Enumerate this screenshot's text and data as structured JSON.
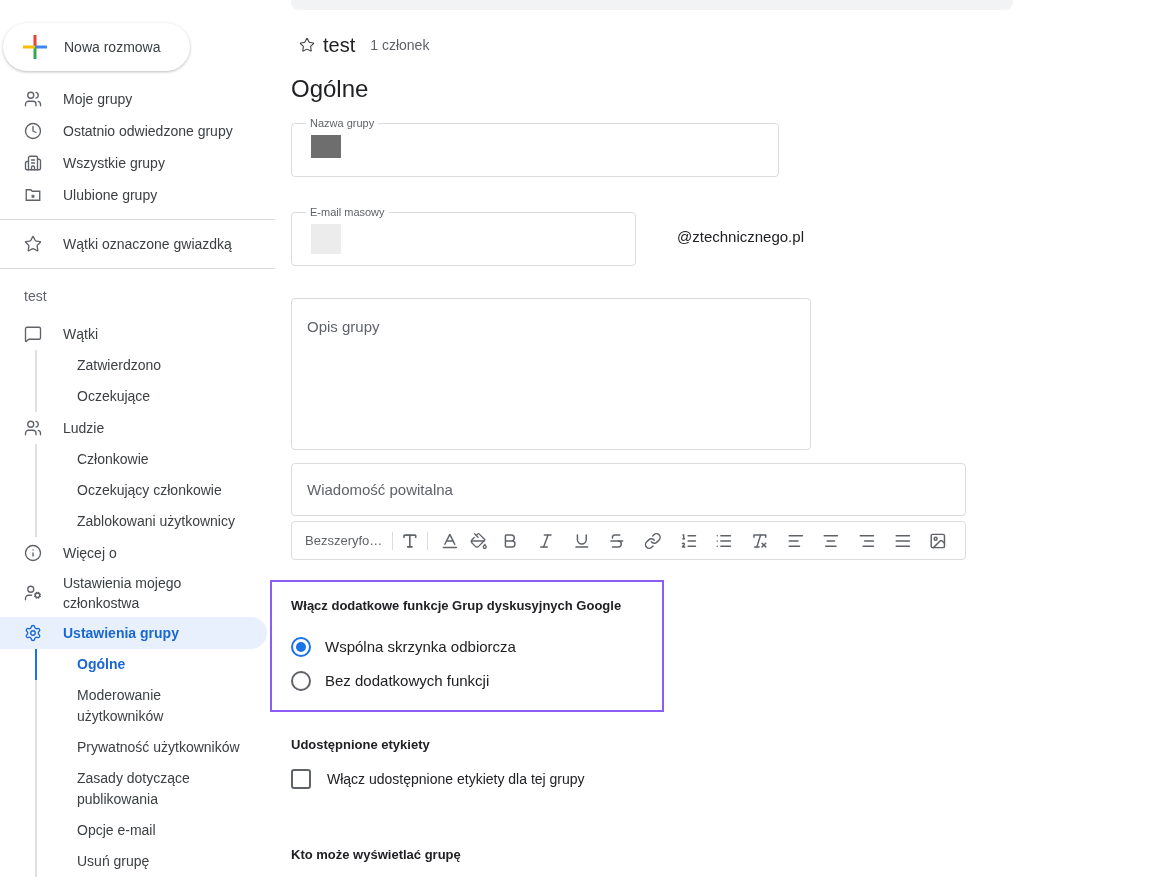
{
  "sidebar": {
    "new_chat_button": "Nowa rozmowa",
    "nav": [
      {
        "label": "Moje grupy"
      },
      {
        "label": "Ostatnio odwiedzone grupy"
      },
      {
        "label": "Wszystkie grupy"
      },
      {
        "label": "Ulubione grupy"
      }
    ],
    "starred": {
      "label": "Wątki oznaczone gwiazdką"
    },
    "group_label": "test",
    "group_nav": [
      {
        "label": "Wątki",
        "selected": false,
        "children": [
          {
            "label": "Zatwierdzono",
            "selected": false
          },
          {
            "label": "Oczekujące",
            "selected": false
          }
        ]
      },
      {
        "label": "Ludzie",
        "selected": false,
        "children": [
          {
            "label": "Członkowie",
            "selected": false
          },
          {
            "label": "Oczekujący członkowie",
            "selected": false
          },
          {
            "label": "Zablokowani użytkownicy",
            "selected": false
          }
        ]
      },
      {
        "label": "Więcej o",
        "selected": false
      },
      {
        "label": "Ustawienia mojego członkostwa",
        "selected": false
      },
      {
        "label": "Ustawienia grupy",
        "selected": true,
        "children": [
          {
            "label": "Ogólne",
            "selected": true
          },
          {
            "label": "Moderowanie użytkowników",
            "selected": false
          },
          {
            "label": "Prywatność użytkowników",
            "selected": false
          },
          {
            "label": "Zasady dotyczące publikowania",
            "selected": false
          },
          {
            "label": "Opcje e-mail",
            "selected": false
          },
          {
            "label": "Usuń grupę",
            "selected": false
          }
        ]
      }
    ]
  },
  "header": {
    "title": "test",
    "members": "1 członek",
    "starred": false
  },
  "page_title": "Ogólne",
  "group_name_field": {
    "label": "Nazwa grupy"
  },
  "email_field": {
    "label": "E-mail masowy",
    "domain": "@ztechnicznego.pl"
  },
  "description_field": {
    "placeholder": "Opis grupy"
  },
  "welcome_field": {
    "placeholder": "Wiadomość powitalna"
  },
  "editor_toolbar": {
    "font": "Bezszeryfo…"
  },
  "features": {
    "heading": "Włącz dodatkowe funkcje Grup dyskusyjnych Google",
    "options": [
      {
        "label": "Wspólna skrzynka odbiorcza",
        "selected": true
      },
      {
        "label": "Bez dodatkowych funkcji",
        "selected": false
      }
    ]
  },
  "shared_labels": {
    "heading": "Udostępnione etykiety",
    "checkbox": {
      "label": "Włącz udostępnione etykiety dla tej grupy",
      "checked": false
    }
  },
  "visibility": {
    "heading": "Kto może wyświetlać grupę"
  }
}
